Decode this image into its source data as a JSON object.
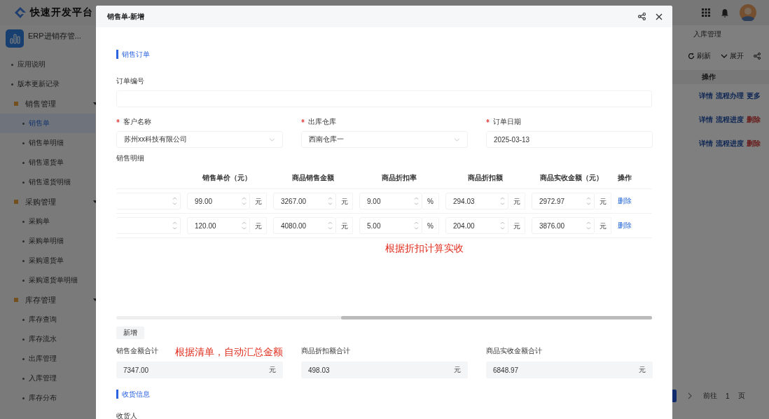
{
  "brand": {
    "title": "快速开发平台"
  },
  "app": {
    "name": "ERP进销存管..."
  },
  "sidebar": {
    "items": [
      {
        "label": "应用说明",
        "selected": false
      },
      {
        "label": "版本更新记录",
        "selected": false
      },
      {
        "label": "销售管理",
        "expanded": true,
        "children": [
          {
            "label": "销售单",
            "selected": true
          },
          {
            "label": "销售单明细",
            "selected": false
          },
          {
            "label": "销售退货单",
            "selected": false
          },
          {
            "label": "销售退货明细",
            "selected": false
          }
        ]
      },
      {
        "label": "采购管理",
        "expanded": true,
        "children": [
          {
            "label": "采购单",
            "selected": false
          },
          {
            "label": "采购单明细",
            "selected": false
          },
          {
            "label": "采购退货单",
            "selected": false
          },
          {
            "label": "采购退货单明细",
            "selected": false
          }
        ]
      },
      {
        "label": "库存管理",
        "expanded": true,
        "children": [
          {
            "label": "库存查询",
            "selected": false
          },
          {
            "label": "库存流水",
            "selected": false
          },
          {
            "label": "出库管理",
            "selected": false
          },
          {
            "label": "入库管理",
            "selected": false
          },
          {
            "label": "库存分布",
            "selected": false
          }
        ]
      }
    ]
  },
  "tabs": [
    {
      "label": "入库管理",
      "selected": false
    }
  ],
  "toolbar": {
    "buttons": [
      {
        "kind": "refresh",
        "label": "刷新"
      },
      {
        "kind": "expand",
        "label": "展开"
      },
      {
        "kind": "share"
      }
    ]
  },
  "list_table": {
    "columns": [
      "操作"
    ],
    "rows": [
      {
        "actions": [
          {
            "label": "详情",
            "kind": "link"
          },
          {
            "label": "流程办理",
            "kind": "link"
          },
          {
            "label": "更多",
            "kind": "link"
          }
        ]
      },
      {
        "actions": [
          {
            "label": "详情",
            "kind": "link"
          },
          {
            "label": "流程进度",
            "kind": "link"
          },
          {
            "label": "删除",
            "kind": "danger"
          }
        ]
      },
      {
        "actions": [
          {
            "label": "详情",
            "kind": "link"
          },
          {
            "label": "流程进度",
            "kind": "link"
          },
          {
            "label": "删除",
            "kind": "danger"
          }
        ]
      }
    ]
  },
  "pagination": {
    "goto_label": "前往",
    "page": "1",
    "page_suffix": "页"
  },
  "modal": {
    "title": "销售单-新增",
    "section_order": "销售订单",
    "order_no": {
      "label": "订单编号",
      "required": false
    },
    "fields": [
      {
        "label": "客户名称",
        "required": true,
        "kind": "select",
        "value": "苏州xx科技有限公司"
      },
      {
        "label": "出库仓库",
        "required": true,
        "kind": "select",
        "value": "西南仓库一"
      },
      {
        "label": "订单日期",
        "required": true,
        "kind": "date",
        "value": "2025-03-13"
      }
    ],
    "detail_label": "销售明细",
    "detail_table": {
      "columns": [
        "销售单价（元）",
        "商品销售金额",
        "商品折扣率",
        "商品折扣额",
        "商品实收金额（元）",
        "操作"
      ],
      "rows": [
        {
          "cells": [
            {
              "value": "99.00",
              "unit": "元"
            },
            {
              "value": "3267.00",
              "unit": "元"
            },
            {
              "value": "9.00",
              "unit": "%"
            },
            {
              "value": "294.03",
              "unit": "元"
            },
            {
              "value": "2972.97",
              "unit": "元"
            }
          ],
          "action": "删除"
        },
        {
          "cells": [
            {
              "value": "120.00",
              "unit": "元"
            },
            {
              "value": "4080.00",
              "unit": "元"
            },
            {
              "value": "5.00",
              "unit": "%"
            },
            {
              "value": "204.00",
              "unit": "元"
            },
            {
              "value": "3876.00",
              "unit": "元"
            }
          ],
          "action": "删除"
        }
      ]
    },
    "note_discount": "根据折扣计算实收",
    "add_button": "新增",
    "note_total": "根据清单，自动汇总金额",
    "totals": [
      {
        "label": "销售金额合计",
        "value": "7347.00",
        "unit": "元"
      },
      {
        "label": "商品折扣额合计",
        "value": "498.03",
        "unit": "元"
      },
      {
        "label": "商品实收金额合计",
        "value": "6848.97",
        "unit": "元"
      }
    ],
    "section_receive": "收货信息",
    "receiver_label": "收货人"
  }
}
